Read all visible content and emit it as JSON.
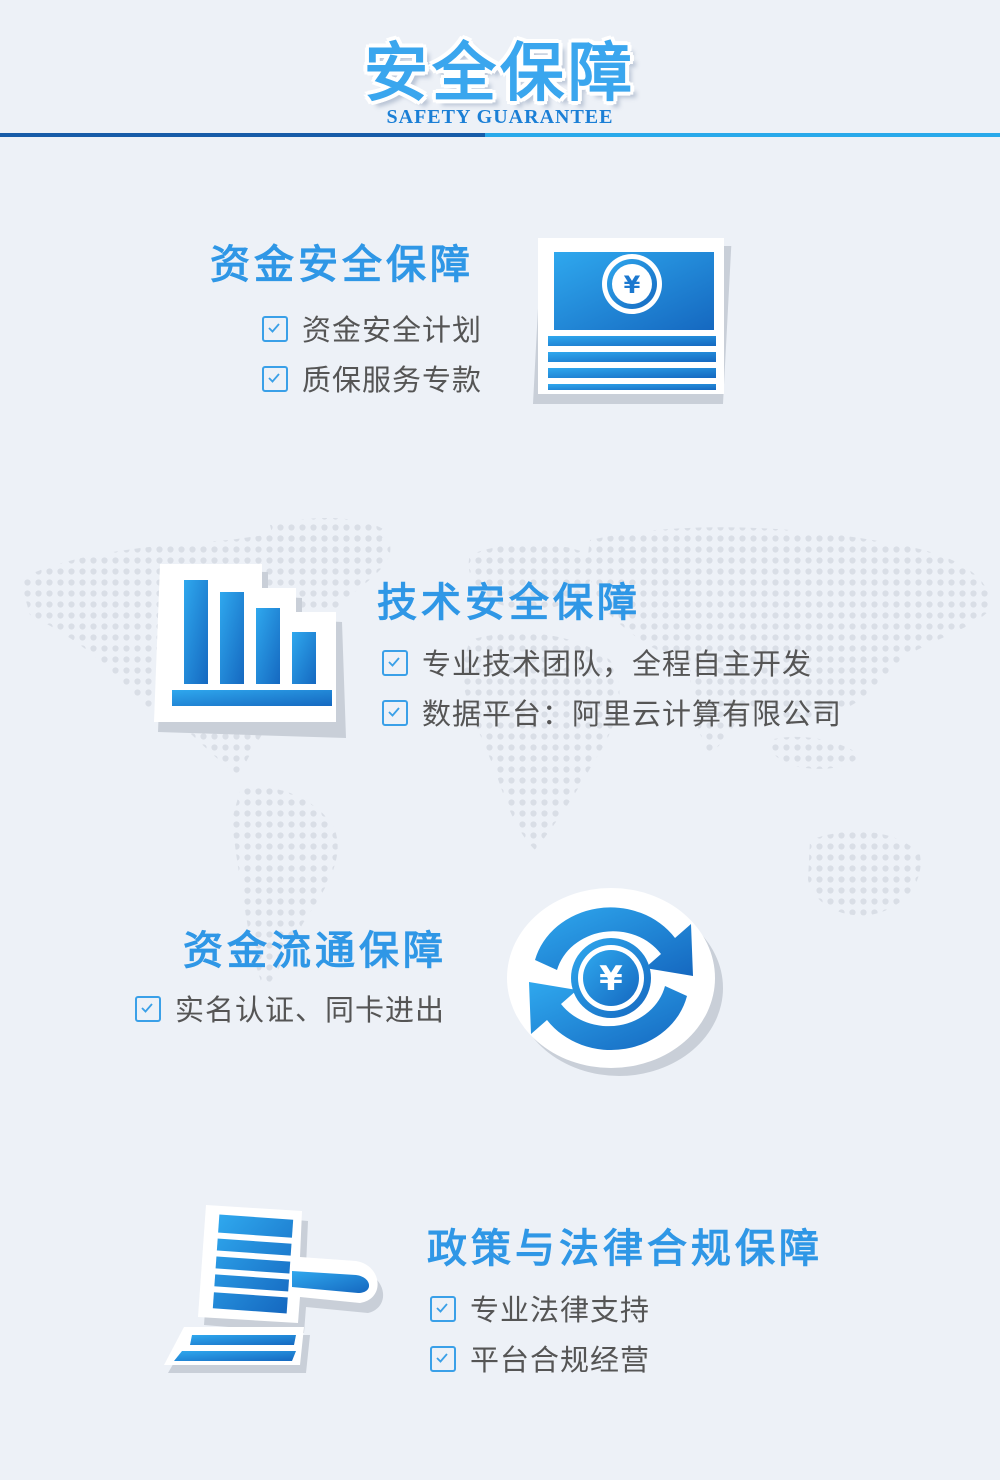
{
  "header": {
    "title_cn": "安全保障",
    "title_en": "SAFETY GUARANTEE"
  },
  "colors": {
    "accent": "#2f97e6",
    "dark_blue": "#175ca8",
    "light_blue": "#29a9ea",
    "background": "#edf1f7"
  },
  "sections": [
    {
      "title": "资金安全保障",
      "icon": "money-stack-icon",
      "items": [
        "资金安全计划",
        "质保服务专款"
      ]
    },
    {
      "title": "技术安全保障",
      "icon": "bar-chart-icon",
      "items": [
        "专业技术团队，全程自主开发",
        "数据平台：阿里云计算有限公司"
      ]
    },
    {
      "title": "资金流通保障",
      "icon": "currency-cycle-icon",
      "items": [
        "实名认证、同卡进出"
      ]
    },
    {
      "title": "政策与法律合规保障",
      "icon": "gavel-icon",
      "items": [
        "专业法律支持",
        "平台合规经营"
      ]
    }
  ],
  "icon_text": {
    "yen_1": "¥",
    "yen_2": "¥"
  }
}
